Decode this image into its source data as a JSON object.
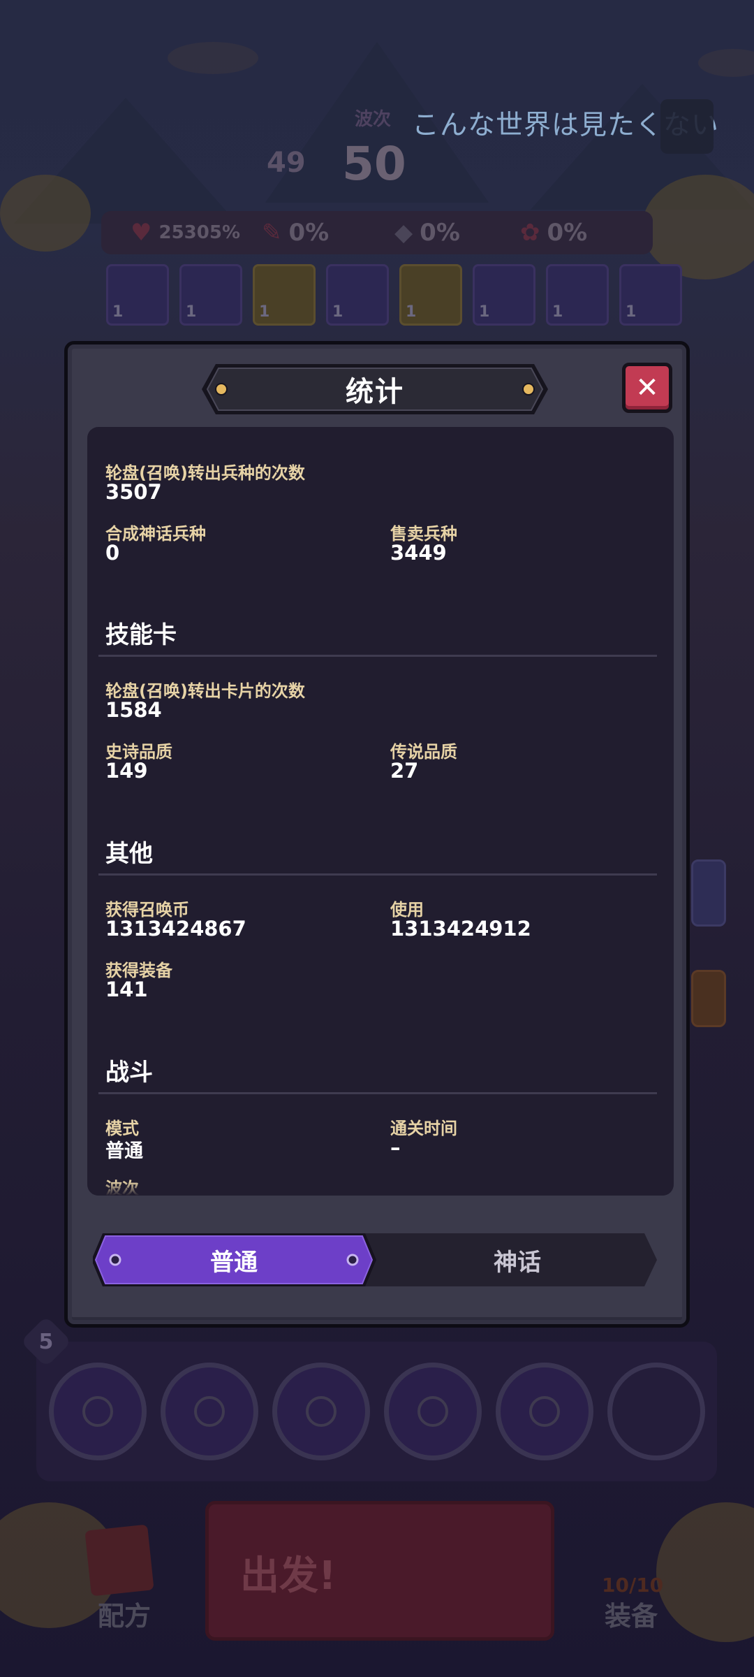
{
  "hud": {
    "caption": "こんな世界は見たくない",
    "wave_label": "波次",
    "wave_previous": "49",
    "wave_current": "50",
    "stats": [
      {
        "icon": "heart-icon",
        "value": "25305%"
      },
      {
        "icon": "potion-icon",
        "value": "0%"
      },
      {
        "icon": "shield-icon",
        "value": "0%"
      },
      {
        "icon": "gear-icon",
        "value": "0%"
      }
    ],
    "skills": [
      "1",
      "1",
      "1",
      "1",
      "1",
      "1",
      "1",
      "1"
    ],
    "squad_level": "5"
  },
  "bottom": {
    "go_label": "出发!",
    "recipe_label": "配方",
    "equip_label": "装备",
    "equip_count": "10/10"
  },
  "modal": {
    "title": "统计",
    "close_icon": "close-icon",
    "units": {
      "summon_label": "轮盘(召唤)转出兵种的次数",
      "summon_value": "3507",
      "mythic_label": "合成神话兵种",
      "mythic_value": "0",
      "sold_label": "售卖兵种",
      "sold_value": "3449"
    },
    "skill_cards": {
      "heading": "技能卡",
      "summon_label": "轮盘(召唤)转出卡片的次数",
      "summon_value": "1584",
      "epic_label": "史诗品质",
      "epic_value": "149",
      "legend_label": "传说品质",
      "legend_value": "27"
    },
    "other": {
      "heading": "其他",
      "coins_got_label": "获得召唤币",
      "coins_got_value": "1313424867",
      "coins_used_label": "使用",
      "coins_used_value": "1313424912",
      "equip_got_label": "获得装备",
      "equip_got_value": "141"
    },
    "battle": {
      "heading": "战斗",
      "mode_label": "模式",
      "mode_value": "普通",
      "time_label": "通关时间",
      "time_value": "–",
      "wave_label": "波次"
    },
    "tabs": [
      {
        "label": "普通",
        "active": true
      },
      {
        "label": "神话",
        "active": false
      }
    ]
  },
  "colors": {
    "accent_purple": "#6d3fc8",
    "label_gold": "#e7d3a6",
    "close_red": "#c23b53",
    "panel": "#211d2f"
  }
}
